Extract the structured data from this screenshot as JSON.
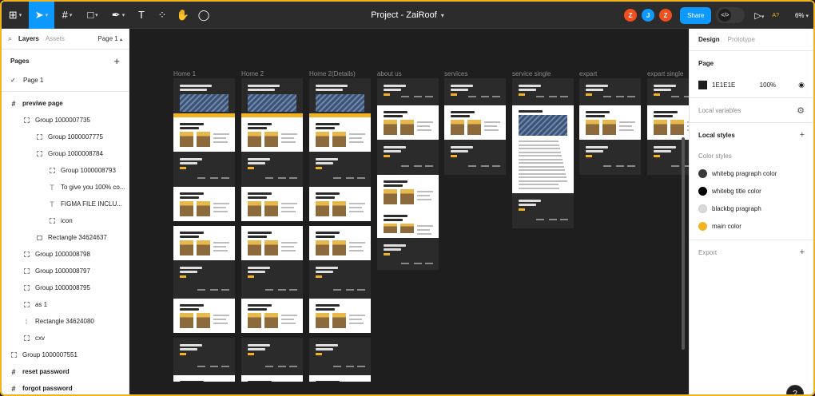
{
  "toolbar": {
    "tools": [
      {
        "name": "main-menu",
        "glyph": "⊞"
      },
      {
        "name": "move-tool",
        "glyph": "➤"
      },
      {
        "name": "frame-tool",
        "glyph": "#"
      },
      {
        "name": "shape-tool",
        "glyph": "□"
      },
      {
        "name": "pen-tool",
        "glyph": "✒"
      },
      {
        "name": "text-tool",
        "glyph": "T"
      },
      {
        "name": "resources-tool",
        "glyph": "⁘"
      },
      {
        "name": "hand-tool",
        "glyph": "✋"
      },
      {
        "name": "comment-tool",
        "glyph": "◯"
      }
    ],
    "project_title": "Project - ZaiRoof",
    "avatars": [
      {
        "letter": "Z",
        "color": "#f24e1e"
      },
      {
        "letter": "J",
        "color": "#0d99ff"
      },
      {
        "letter": "Z",
        "color": "#f24e1e"
      }
    ],
    "share_label": "Share",
    "dev_mode_glyph": "</>",
    "present_glyph": "▷",
    "ai_label": "A?",
    "zoom": "6%"
  },
  "left_panel": {
    "tab_layers": "Layers",
    "tab_assets": "Assets",
    "page_selector": "Page 1",
    "pages_heading": "Pages",
    "pages": [
      {
        "label": "Page 1",
        "checked": true
      }
    ],
    "layers": [
      {
        "label": "previwe page",
        "type": "frame",
        "indent": 0,
        "bold": true
      },
      {
        "label": "Group 1000007735",
        "type": "group",
        "indent": 1,
        "bold": false
      },
      {
        "label": "Group 1000007775",
        "type": "group",
        "indent": 2,
        "bold": false
      },
      {
        "label": "Group 1000008784",
        "type": "group",
        "indent": 2,
        "bold": false
      },
      {
        "label": "Group 1000008793",
        "type": "group",
        "indent": 3,
        "bold": false
      },
      {
        "label": "To give you 100% co...",
        "type": "text",
        "indent": 3,
        "bold": false
      },
      {
        "label": "FIGMA FILE INCLU...",
        "type": "text",
        "indent": 3,
        "bold": false
      },
      {
        "label": "icon",
        "type": "group",
        "indent": 3,
        "bold": false
      },
      {
        "label": "Rectangle 34624637",
        "type": "rect",
        "indent": 2,
        "bold": false
      },
      {
        "label": "Group 1000008798",
        "type": "group",
        "indent": 1,
        "bold": false
      },
      {
        "label": "Group 1000008797",
        "type": "group",
        "indent": 1,
        "bold": false
      },
      {
        "label": "Group 1000008795",
        "type": "group",
        "indent": 1,
        "bold": false
      },
      {
        "label": "as 1",
        "type": "group",
        "indent": 1,
        "bold": false
      },
      {
        "label": "Rectangle 34624080",
        "type": "line",
        "indent": 1,
        "bold": false
      },
      {
        "label": "cxv",
        "type": "group",
        "indent": 1,
        "bold": false
      },
      {
        "label": "Group 1000007551",
        "type": "group",
        "indent": 0,
        "bold": false
      },
      {
        "label": "reset password",
        "type": "frame",
        "indent": 0,
        "bold": true
      },
      {
        "label": "forgot password",
        "type": "frame",
        "indent": 0,
        "bold": true
      }
    ]
  },
  "canvas": {
    "frames": [
      {
        "label": "Home 1"
      },
      {
        "label": "Home 2"
      },
      {
        "label": "Home 2(Details)"
      },
      {
        "label": "about us"
      },
      {
        "label": "services"
      },
      {
        "label": "service single"
      },
      {
        "label": "expart"
      },
      {
        "label": "expart single"
      }
    ]
  },
  "right_panel": {
    "tab_design": "Design",
    "tab_prototype": "Prototype",
    "page_heading": "Page",
    "page_color": "1E1E1E",
    "page_opacity": "100%",
    "local_variables": "Local variables",
    "local_styles": "Local styles",
    "color_styles_heading": "Color styles",
    "color_styles": [
      {
        "label": "whitebg pragraph color",
        "color": "#3a3a3a"
      },
      {
        "label": "whitebg title color",
        "color": "#000000"
      },
      {
        "label": "blackbg pragraph",
        "color": "#d9d9d9"
      },
      {
        "label": "main color",
        "color": "#f0b323"
      }
    ],
    "export_label": "Export"
  },
  "help_glyph": "?"
}
